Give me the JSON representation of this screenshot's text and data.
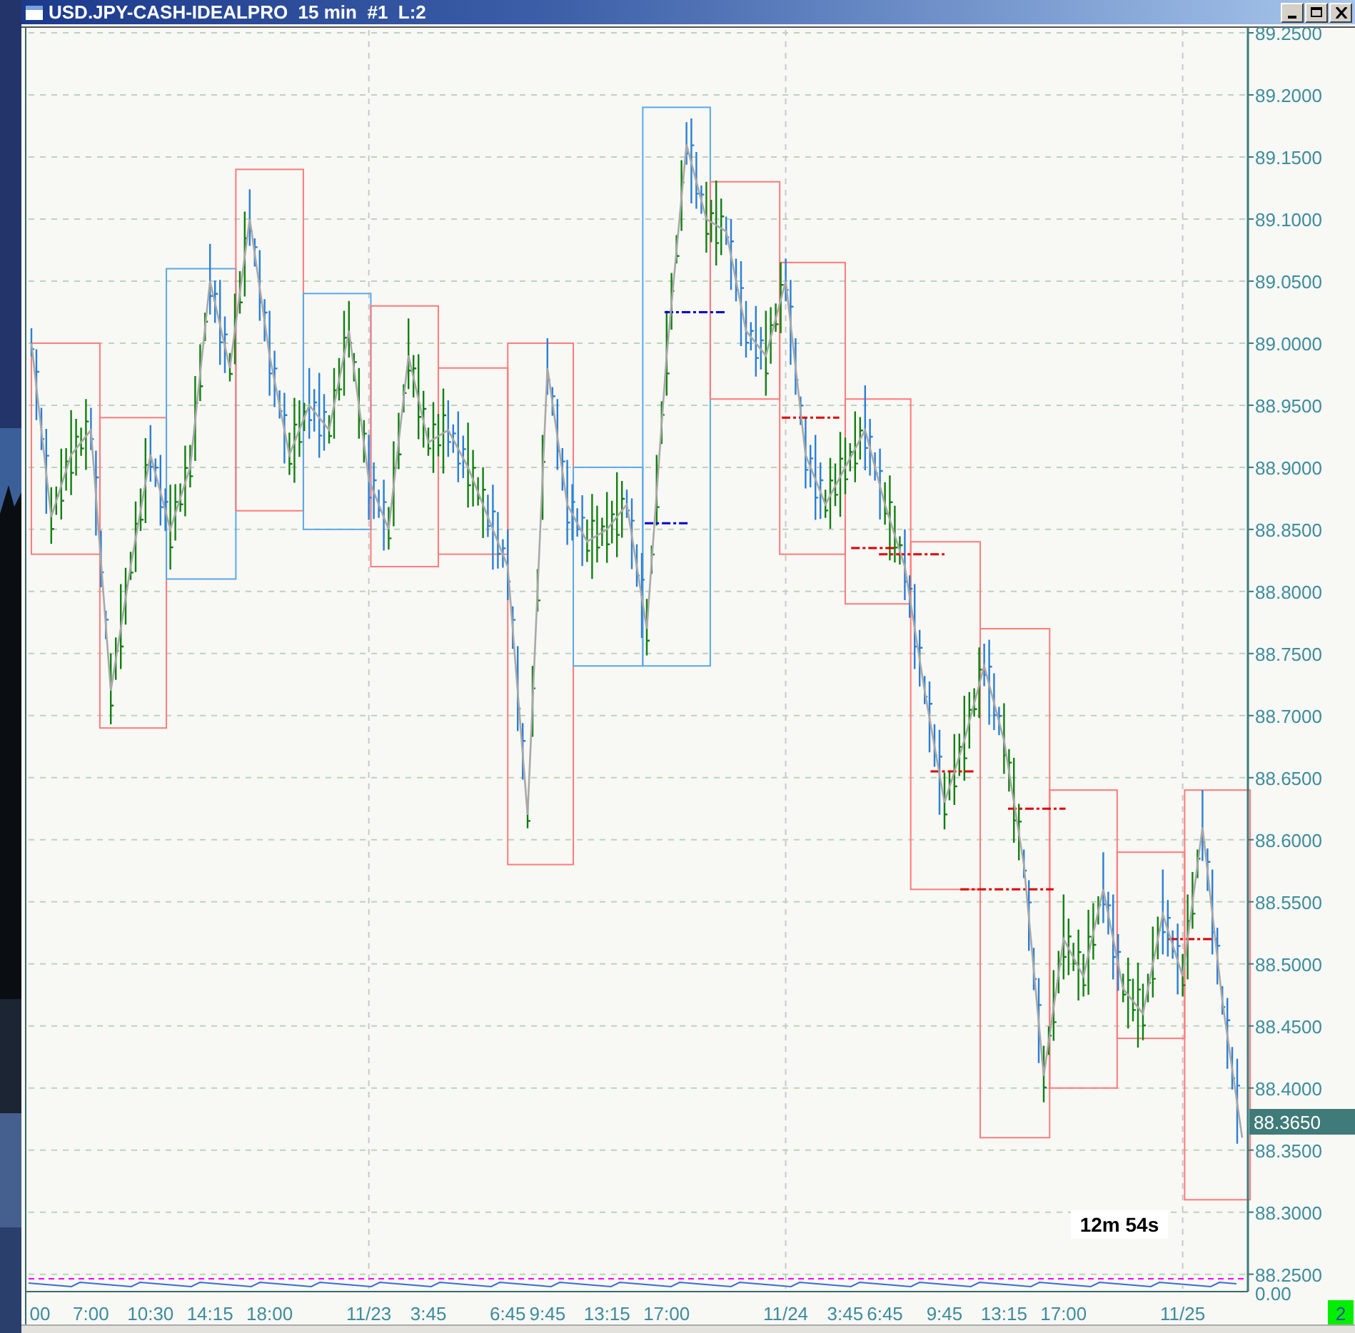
{
  "window": {
    "title": "USD.JPY-CASH-IDEALPRO  15 min  #1  L:2"
  },
  "chart": {
    "chart_data": {
      "type": "line",
      "ylim": [
        88.236,
        89.25
      ],
      "grid": true,
      "categories": [
        "00",
        null,
        null,
        "7:00",
        null,
        null,
        "10:30",
        null,
        null,
        "14:15",
        null,
        null,
        "18:00",
        null,
        null,
        null,
        null,
        "11/23",
        null,
        null,
        "3:45",
        null,
        null,
        null,
        "6:45",
        null,
        "9:45",
        null,
        null,
        "13:15",
        null,
        null,
        "17:00",
        null,
        null,
        null,
        null,
        null,
        "11/24",
        null,
        null,
        "3:45",
        null,
        "6:45",
        null,
        null,
        "9:45",
        null,
        null,
        "13:15",
        null,
        null,
        "17:00",
        null,
        null,
        null,
        null,
        null,
        "11/25",
        null,
        null,
        null
      ],
      "yticks": [
        {
          "value": 89.25,
          "label": "89.2500"
        },
        {
          "value": 89.2,
          "label": "89.2000"
        },
        {
          "value": 89.15,
          "label": "89.1500"
        },
        {
          "value": 89.1,
          "label": "89.1000"
        },
        {
          "value": 89.05,
          "label": "89.0500"
        },
        {
          "value": 89.0,
          "label": "89.0000"
        },
        {
          "value": 88.95,
          "label": "88.9500"
        },
        {
          "value": 88.9,
          "label": "88.9000"
        },
        {
          "value": 88.85,
          "label": "88.8500"
        },
        {
          "value": 88.8,
          "label": "88.8000"
        },
        {
          "value": 88.75,
          "label": "88.7500"
        },
        {
          "value": 88.7,
          "label": "88.7000"
        },
        {
          "value": 88.65,
          "label": "88.6500"
        },
        {
          "value": 88.6,
          "label": "88.6000"
        },
        {
          "value": 88.55,
          "label": "88.5500"
        },
        {
          "value": 88.5,
          "label": "88.5000"
        },
        {
          "value": 88.45,
          "label": "88.4500"
        },
        {
          "value": 88.4,
          "label": "88.4000"
        },
        {
          "value": 88.35,
          "label": "88.3500"
        },
        {
          "value": 88.3,
          "label": "88.3000"
        },
        {
          "value": 88.25,
          "label": "88.2500"
        }
      ],
      "series": [
        {
          "color": "#a8a8a8",
          "values": [
            89.0,
            88.86,
            88.91,
            88.93,
            88.72,
            88.82,
            88.91,
            88.85,
            88.9,
            89.05,
            88.98,
            89.1,
            88.99,
            88.91,
            88.95,
            88.93,
            89.01,
            88.89,
            88.85,
            88.99,
            88.92,
            88.93,
            88.9,
            88.86,
            88.82,
            88.62,
            88.98,
            88.87,
            88.84,
            88.85,
            88.87,
            88.77,
            88.99,
            89.16,
            89.1,
            89.09,
            89.01,
            88.99,
            89.05,
            88.91,
            88.87,
            88.9,
            88.93,
            88.87,
            88.82,
            88.72,
            88.63,
            88.68,
            88.74,
            88.68,
            88.58,
            88.41,
            88.52,
            88.49,
            88.56,
            88.48,
            88.46,
            88.54,
            88.49,
            88.61,
            88.47,
            88.36
          ]
        }
      ]
    },
    "last_price": "88.3650",
    "countdown": "12m 54s",
    "indicator_label": "0.00"
  },
  "status_badge": "2"
}
